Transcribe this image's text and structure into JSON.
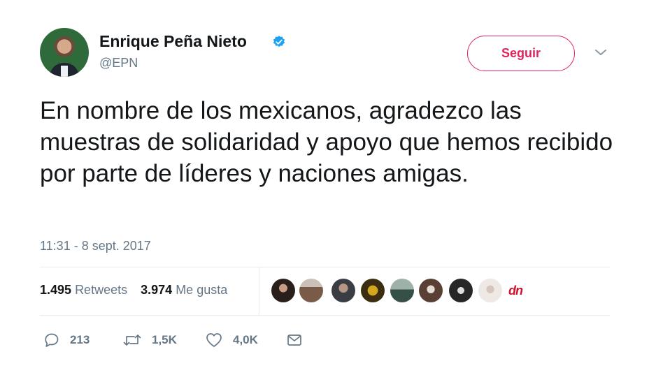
{
  "author": {
    "name": "Enrique Peña Nieto",
    "handle": "@EPN",
    "verified": true
  },
  "follow_button": {
    "label": "Seguir"
  },
  "tweet": {
    "text": "En nombre de los mexicanos, agradezco las muestras de solidaridad y apoyo que hemos recibido por parte de líderes y naciones amigas.",
    "timestamp": "11:31 - 8 sept. 2017"
  },
  "stats": {
    "retweets_count": "1.495",
    "retweets_label": "Retweets",
    "likes_count": "3.974",
    "likes_label": "Me gusta"
  },
  "likers": [
    "avatar-1",
    "avatar-2",
    "avatar-3",
    "avatar-4",
    "avatar-5",
    "avatar-6",
    "avatar-7",
    "avatar-8"
  ],
  "watermark": "dn",
  "actions": {
    "replies": "213",
    "retweets": "1,5K",
    "likes": "4,0K"
  },
  "colors": {
    "accent": "#e0245e",
    "verified": "#1da1f2",
    "muted": "#657786",
    "text": "#14171a"
  },
  "icons": {
    "verified": "verified-badge-icon",
    "caret": "chevron-down-icon",
    "reply": "reply-icon",
    "retweet": "retweet-icon",
    "like": "heart-icon",
    "message": "envelope-icon"
  }
}
